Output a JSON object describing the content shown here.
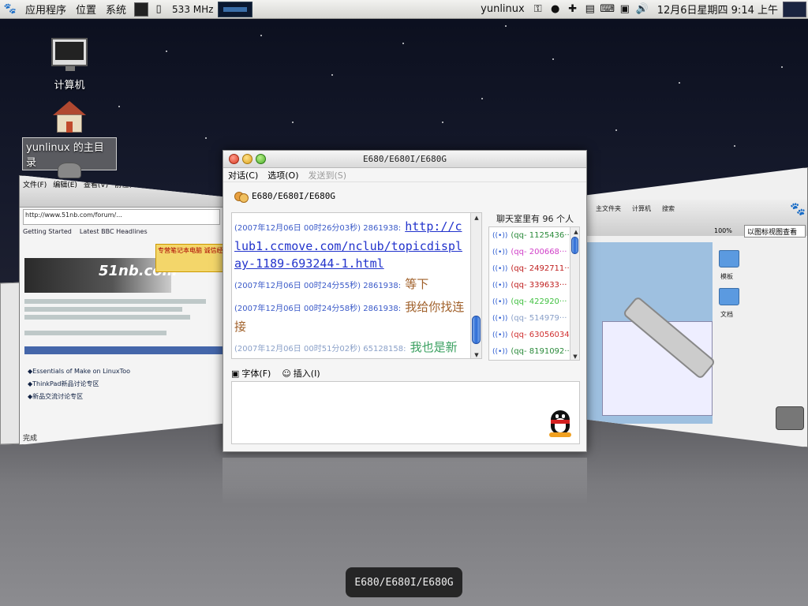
{
  "top_panel": {
    "menus": [
      "应用程序",
      "位置",
      "系统"
    ],
    "cpu_freq": "533 MHz",
    "user": "yunlinux",
    "clock": "12月6日星期四  9:14 上午"
  },
  "desktop": {
    "icons": [
      {
        "label": "计算机"
      },
      {
        "label": "yunlinux 的主目录"
      }
    ]
  },
  "left_window": {
    "toolbar": [
      "文件(F)",
      "编辑(E)",
      "查看(V)",
      "前往(G)",
      "书签(B)"
    ],
    "address": "http://www.51nb.com/forum/...",
    "bookmarks": [
      "Getting Started",
      "Latest BBC Headlines"
    ],
    "logo": "51nb.com",
    "ad": "专营笔记本电脑 诚信经营",
    "status": "完成",
    "rows": [
      "◆Essentials of Make on LinuxToo",
      "◆ThinkPad新品讨论专区",
      "◆新品交流讨论专区"
    ]
  },
  "right_window": {
    "toolbar": [
      "主文件夹",
      "计算机",
      "搜索"
    ],
    "zoom": "100%",
    "view": "以图标视图查看",
    "folders": [
      "模板",
      "文档"
    ]
  },
  "chat": {
    "title": "E680/E680I/E680G",
    "menu": {
      "dialog": "对话(C)",
      "options": "选项(O)",
      "send_to": "发送到(S)"
    },
    "group_name": "E680/E680I/E680G",
    "messages": [
      {
        "meta": "(2007年12月06日 00时26分03秒) 2861938:",
        "link": "http://club1.ccmove.com/nclub/topicdisplay-1189-693244-1.html"
      },
      {
        "meta": "(2007年12月06日 00时24分55秒) 2861938:",
        "text": "等下"
      },
      {
        "meta": "(2007年12月06日 00时24分58秒) 2861938:",
        "text": "我给你找连接"
      },
      {
        "meta": "(2007年12月06日 00时51分02秒) 65128158:",
        "text": "我也是新来的"
      }
    ],
    "members_title": "聊天室里有 96 个人",
    "members": [
      {
        "id": "(qq- 1125436···",
        "color": "#2a8a3a"
      },
      {
        "id": "(qq- 200668···",
        "color": "#d040c8"
      },
      {
        "id": "(qq- 2492711···",
        "color": "#c02020"
      },
      {
        "id": "(qq- 339633···",
        "color": "#c02020"
      },
      {
        "id": "(qq- 422920···",
        "color": "#40c040"
      },
      {
        "id": "(qq- 514979···",
        "color": "#8aa0c8"
      },
      {
        "id": "(qq- 63056034)",
        "color": "#d03030"
      },
      {
        "id": "(qq- 8191092···",
        "color": "#2a8a3a"
      }
    ],
    "font_label": "字体(F)",
    "insert_label": "插入(I)"
  },
  "switcher": {
    "label": "E680/E680I/E680G"
  }
}
